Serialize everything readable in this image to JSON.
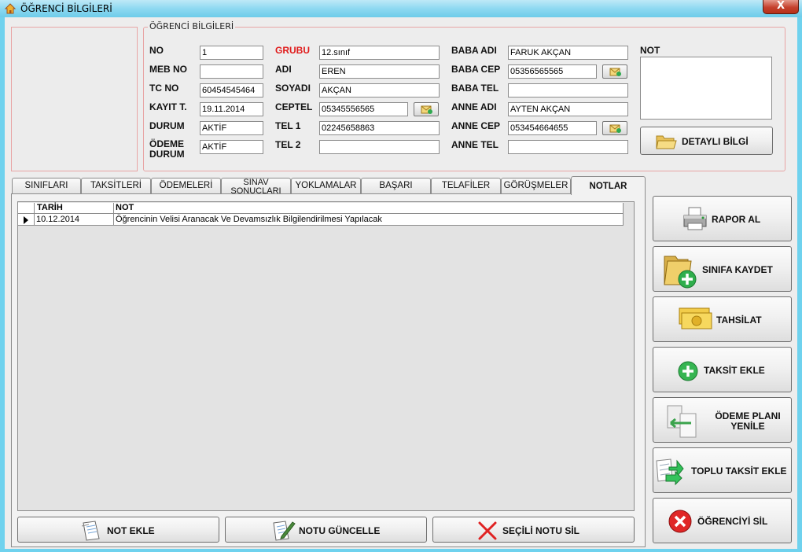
{
  "window": {
    "title": "ÖĞRENCİ BİLGİLERİ",
    "close_glyph": "X"
  },
  "student_group": {
    "title": "ÖĞRENCİ BİLGİLERİ",
    "fields": {
      "no": {
        "label": "NO",
        "value": "1"
      },
      "meb_no": {
        "label": "MEB NO",
        "value": ""
      },
      "tc_no": {
        "label": "TC NO",
        "value": "60454545464"
      },
      "kayit_t": {
        "label": "KAYIT T.",
        "value": "19.11.2014"
      },
      "durum": {
        "label": "DURUM",
        "value": "AKTİF"
      },
      "odeme_durum": {
        "label": "ÖDEME DURUM",
        "value": "AKTİF"
      },
      "grubu": {
        "label": "GRUBU",
        "value": "12.sınıf"
      },
      "adi": {
        "label": "ADI",
        "value": "EREN"
      },
      "soyadi": {
        "label": "SOYADI",
        "value": "AKÇAN"
      },
      "ceptel": {
        "label": "CEPTEL",
        "value": "05345556565"
      },
      "tel1": {
        "label": "TEL 1",
        "value": "02245658863"
      },
      "tel2": {
        "label": "TEL 2",
        "value": ""
      },
      "baba_adi": {
        "label": "BABA ADI",
        "value": "FARUK AKÇAN"
      },
      "baba_cep": {
        "label": "BABA CEP",
        "value": "05356565565"
      },
      "baba_tel": {
        "label": "BABA TEL",
        "value": ""
      },
      "anne_adi": {
        "label": "ANNE ADI",
        "value": "AYTEN AKÇAN"
      },
      "anne_cep": {
        "label": "ANNE CEP",
        "value": "053454664655"
      },
      "anne_tel": {
        "label": "ANNE TEL",
        "value": ""
      }
    },
    "note_label": "NOT",
    "note_value": "",
    "detail_button": "DETAYLI BİLGİ"
  },
  "tabs": [
    {
      "label": "SINIFLARI",
      "active": false
    },
    {
      "label": "TAKSİTLERİ",
      "active": false
    },
    {
      "label": "ÖDEMELERİ",
      "active": false
    },
    {
      "label": "SINAV SONUÇLARI",
      "active": false
    },
    {
      "label": "YOKLAMALAR",
      "active": false
    },
    {
      "label": "BAŞARI GRAFİĞİ",
      "active": false
    },
    {
      "label": "TELAFİLER",
      "active": false
    },
    {
      "label": "GÖRÜŞMELER",
      "active": false
    },
    {
      "label": "NOTLAR",
      "active": true
    }
  ],
  "notes_grid": {
    "columns": [
      "TARİH",
      "NOT"
    ],
    "rows": [
      {
        "date": "10.12.2014",
        "note": "Öğrencinin Velisi Aranacak Ve Devamsızlık Bilgilendirilmesi Yapılacak"
      }
    ]
  },
  "note_actions": {
    "add": "NOT EKLE",
    "update": "NOTU GÜNCELLE",
    "delete": "SEÇİLİ NOTU  SİL"
  },
  "side_actions": {
    "report": "RAPOR AL",
    "save_class": "SINIFA KAYDET",
    "collection": "TAHSİLAT",
    "add_installment": "TAKSİT EKLE",
    "renew_plan_line1": "ÖDEME PLANI",
    "renew_plan_line2": "YENİLE",
    "bulk_installment": "TOPLU TAKSİT EKLE",
    "delete_student": "ÖĞRENCİYİ SİL"
  },
  "colors": {
    "accent_red": "#e01b1b",
    "frame": "#6fd2ee",
    "group_border": "#e8a5a5"
  }
}
